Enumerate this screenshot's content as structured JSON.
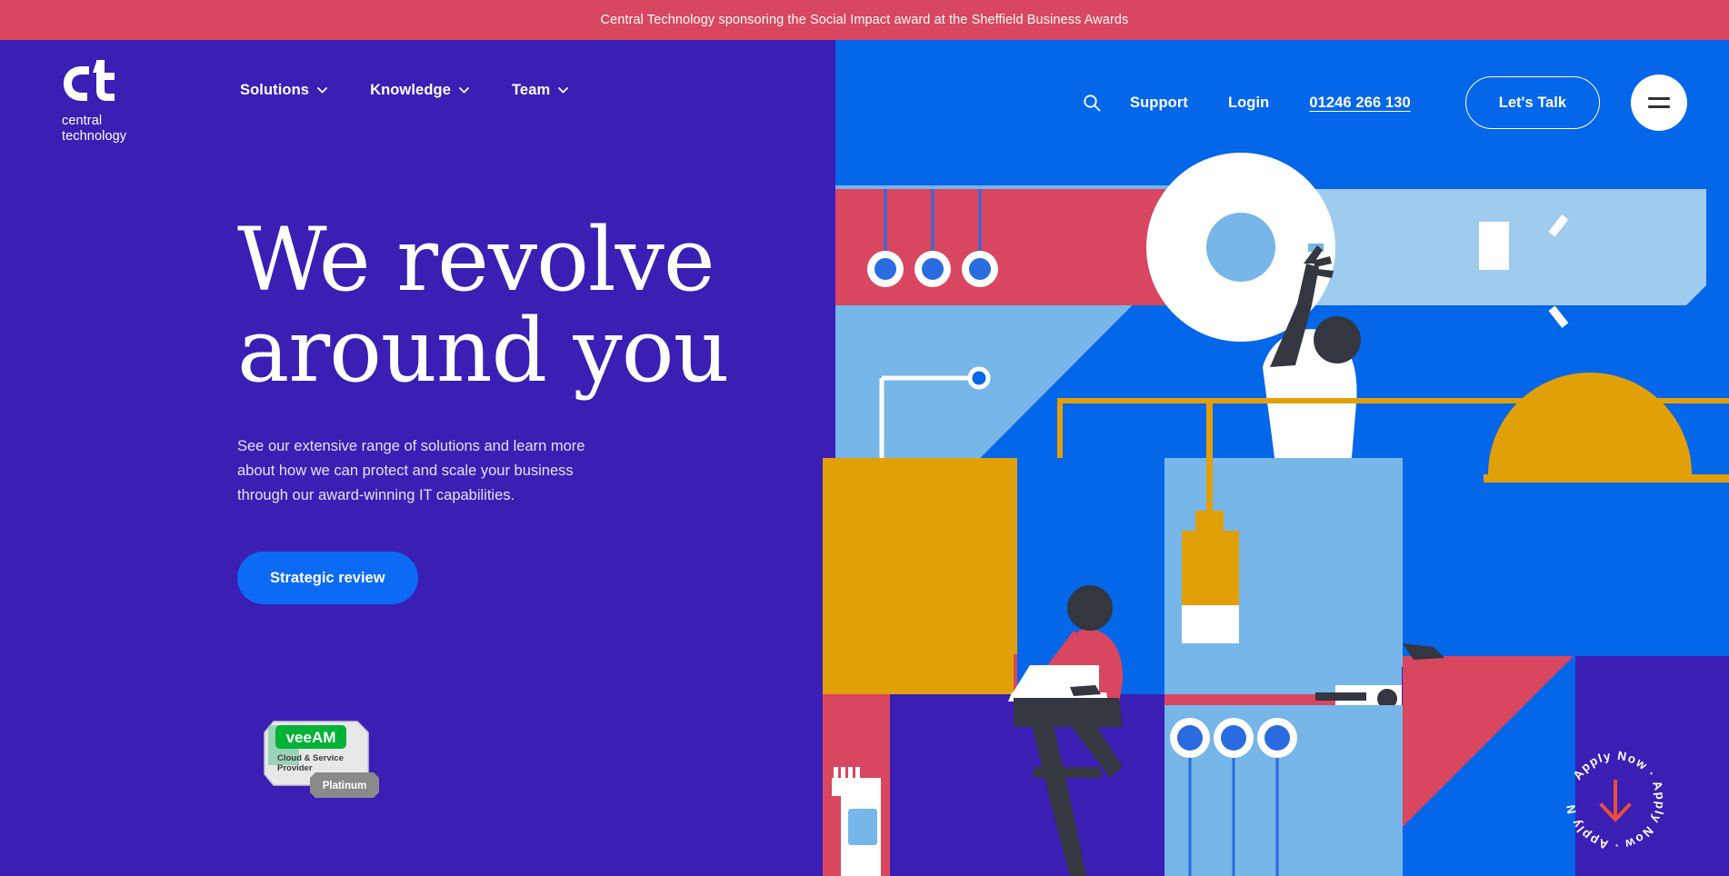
{
  "announcement": {
    "text": "Central Technology sponsoring the Social Impact award at the Sheffield Business Awards",
    "bg": "#D9465F"
  },
  "brand": {
    "logo_mark": "ct-monogram-icon",
    "name_line1": "central",
    "name_line2": "technology",
    "purple": "#3B1EB4",
    "blue": "#0466E8",
    "accent_blue": "#0C6BF4",
    "red": "#D9465F",
    "yellow": "#E2A008",
    "light_blue": "#76B6E8"
  },
  "nav": {
    "primary": [
      {
        "label": "Solutions",
        "icon": "chevron-down-icon",
        "has_dropdown": true
      },
      {
        "label": "Knowledge",
        "icon": "chevron-down-icon",
        "has_dropdown": true
      },
      {
        "label": "Team",
        "icon": "chevron-down-icon",
        "has_dropdown": true
      }
    ],
    "search_icon": "search-icon",
    "support_label": "Support",
    "login_label": "Login",
    "phone": "01246 266 130",
    "cta_label": "Let's Talk",
    "menu_icon": "hamburger-menu-icon"
  },
  "hero": {
    "heading_line1": "We revolve",
    "heading_line2": "around you",
    "paragraph": "See our extensive range of solutions and learn more about how we can protect and scale your business through our award-winning IT capabilities.",
    "cta_label": "Strategic review"
  },
  "badge_veeam": {
    "brand": "veeAM",
    "tier_line1": "Cloud & Service",
    "tier_line2": "Provider",
    "level": "Platinum"
  },
  "apply_badge": {
    "text": "Apply Now • Apply Now • Apply Now • ",
    "arrow_icon": "arrow-down-icon",
    "arrow_color": "#E8503C"
  },
  "illustration": {
    "name": "abstract-tech-collage",
    "elements": [
      "pendulum-dots-panel",
      "disc-icon",
      "node-graph-icon",
      "person-waving-icon",
      "person-with-laptop-icon",
      "pendant-lamp-icon",
      "server-rack-icon",
      "file-box-icon",
      "usb-drive-icon"
    ]
  }
}
